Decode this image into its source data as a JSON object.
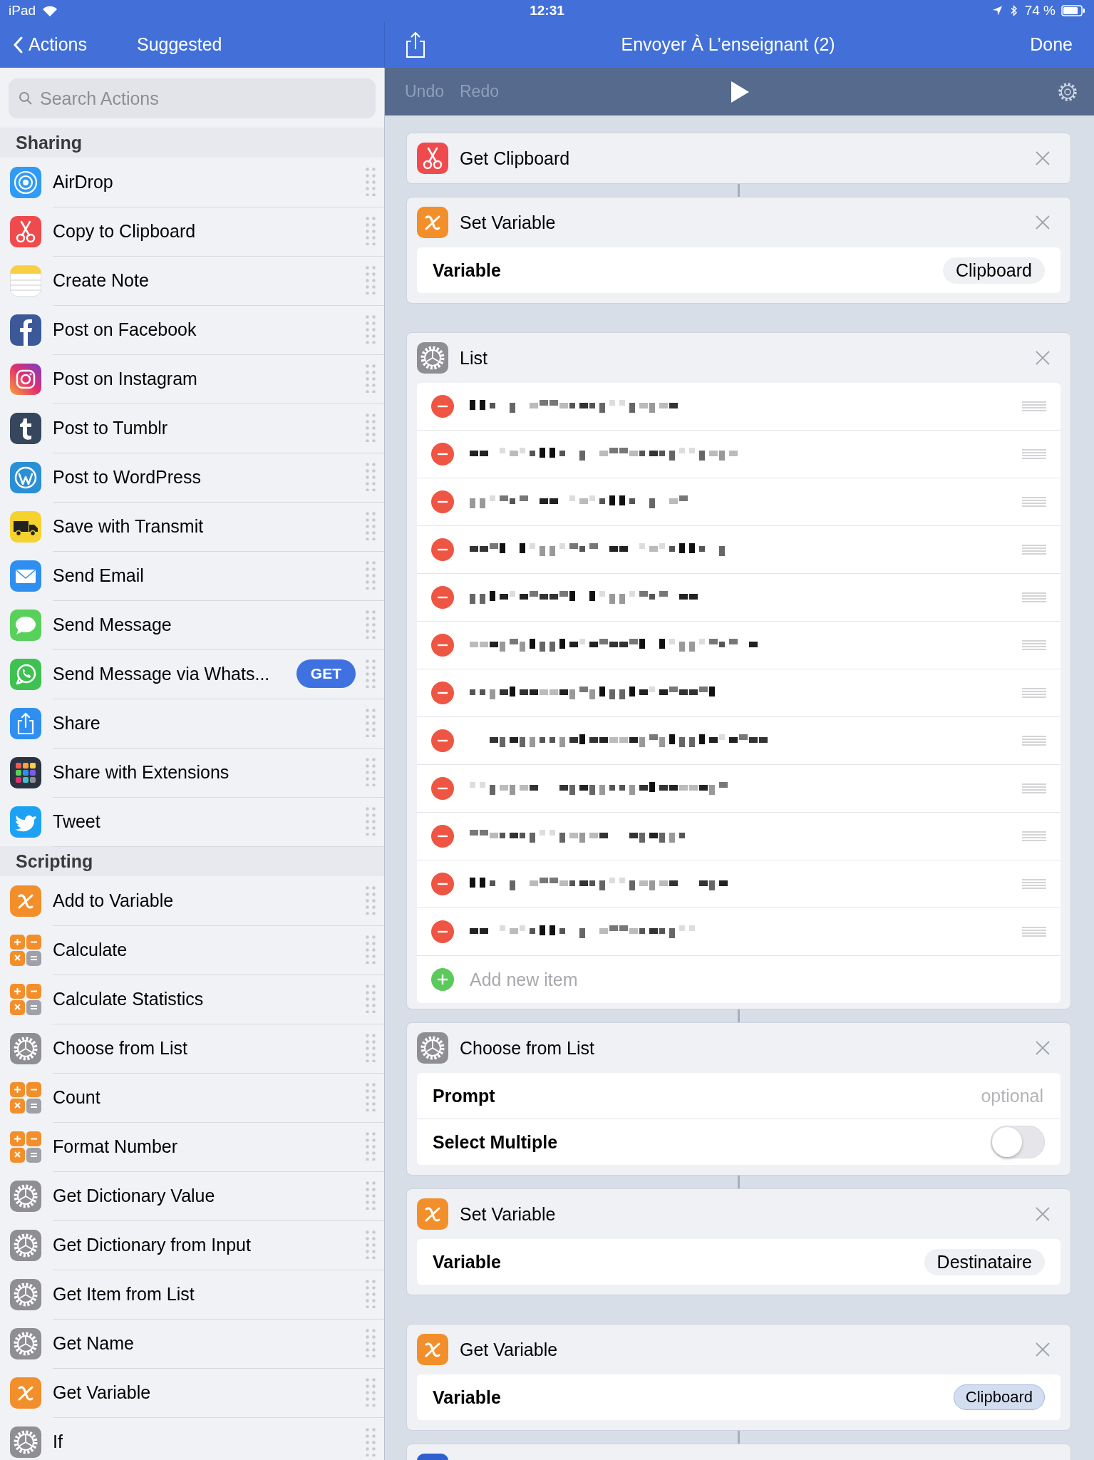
{
  "status_bar": {
    "carrier": "iPad",
    "time": "12:31",
    "battery": "74 %"
  },
  "left_nav": {
    "back": "Actions",
    "title": "Suggested"
  },
  "right_nav": {
    "title": "Envoyer À L’enseignant (2)",
    "done": "Done"
  },
  "search": {
    "placeholder": "Search Actions"
  },
  "sections": [
    {
      "title": "Sharing",
      "items": [
        {
          "label": "AirDrop",
          "kind": "airdrop"
        },
        {
          "label": "Copy to Clipboard",
          "kind": "scissors"
        },
        {
          "label": "Create Note",
          "kind": "note"
        },
        {
          "label": "Post on Facebook",
          "kind": "facebook"
        },
        {
          "label": "Post on Instagram",
          "kind": "instagram"
        },
        {
          "label": "Post to Tumblr",
          "kind": "tumblr"
        },
        {
          "label": "Post to WordPress",
          "kind": "wordpress"
        },
        {
          "label": "Save with Transmit",
          "kind": "truck"
        },
        {
          "label": "Send Email",
          "kind": "email"
        },
        {
          "label": "Send Message",
          "kind": "message"
        },
        {
          "label": "Send Message via Whats...",
          "kind": "whatsapp",
          "button": "GET"
        },
        {
          "label": "Share",
          "kind": "share"
        },
        {
          "label": "Share with Extensions",
          "kind": "extensions"
        },
        {
          "label": "Tweet",
          "kind": "twitter"
        }
      ]
    },
    {
      "title": "Scripting",
      "items": [
        {
          "label": "Add to Variable",
          "kind": "variable"
        },
        {
          "label": "Calculate",
          "kind": "calculator"
        },
        {
          "label": "Calculate Statistics",
          "kind": "calculator"
        },
        {
          "label": "Choose from List",
          "kind": "gear"
        },
        {
          "label": "Count",
          "kind": "calculator"
        },
        {
          "label": "Format Number",
          "kind": "calculator"
        },
        {
          "label": "Get Dictionary Value",
          "kind": "gear"
        },
        {
          "label": "Get Dictionary from Input",
          "kind": "gear"
        },
        {
          "label": "Get Item from List",
          "kind": "gear"
        },
        {
          "label": "Get Name",
          "kind": "gear"
        },
        {
          "label": "Get Variable",
          "kind": "variable"
        },
        {
          "label": "If",
          "kind": "gear"
        }
      ]
    }
  ],
  "toolbar": {
    "undo": {
      "label": "Undo",
      "disabled": true
    },
    "redo": {
      "label": "Redo",
      "disabled": true
    }
  },
  "cards": [
    {
      "kind": "scissors",
      "title": "Get Clipboard",
      "linked": false
    },
    {
      "kind": "variable",
      "title": "Set Variable",
      "linked": true,
      "fields": [
        {
          "kind": "pill",
          "label": "Variable",
          "value": "Clipboard",
          "token": false
        }
      ]
    },
    {
      "kind": "gear",
      "title": "List",
      "linked": false,
      "items": [
        {
          "kind": "redacted"
        },
        {
          "kind": "redacted"
        },
        {
          "kind": "redacted"
        },
        {
          "kind": "redacted"
        },
        {
          "kind": "redacted"
        },
        {
          "kind": "redacted"
        },
        {
          "kind": "redacted"
        },
        {
          "kind": "redacted"
        },
        {
          "kind": "redacted"
        },
        {
          "kind": "redacted"
        },
        {
          "kind": "redacted"
        },
        {
          "kind": "redacted"
        }
      ],
      "add_label": "Add new item"
    },
    {
      "kind": "gear",
      "title": "Choose from List",
      "linked": true,
      "fields": [
        {
          "kind": "text",
          "label": "Prompt",
          "placeholder": "optional"
        },
        {
          "kind": "toggle",
          "label": "Select Multiple",
          "on": false
        }
      ]
    },
    {
      "kind": "variable",
      "title": "Set Variable",
      "linked": true,
      "fields": [
        {
          "kind": "pill",
          "label": "Variable",
          "value": "Destinataire",
          "token": false
        }
      ]
    },
    {
      "kind": "variable",
      "title": "Get Variable",
      "linked": false,
      "fields": [
        {
          "kind": "pill",
          "label": "Variable",
          "value": "Clipboard",
          "token": true
        }
      ]
    },
    {
      "kind": "blue",
      "linked": true
    }
  ]
}
